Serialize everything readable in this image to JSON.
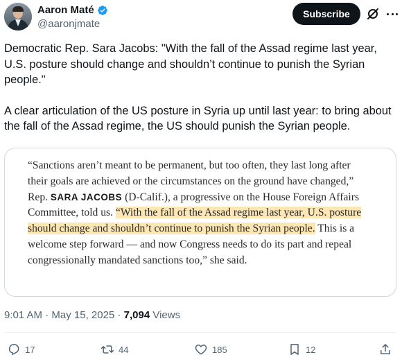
{
  "author": {
    "display_name": "Aaron Maté",
    "handle": "@aaronjmate"
  },
  "header": {
    "subscribe_label": "Subscribe"
  },
  "tweet": {
    "paragraph_1": "Democratic Rep. Sara Jacobs: \"With the fall of the Assad regime last year, U.S. posture should change and shouldn’t continue to punish the Syrian people.\"",
    "paragraph_2": "A clear articulation of the US posture in Syria up until last year: to bring about the fall of the Assad regime, the US should punish the Syrian people."
  },
  "media": {
    "quote_part_1": "“Sanctions aren’t meant to be permanent, but too often, they last long after their goals are achieved or the circumstances on the ground have changed,” Rep. ",
    "quote_name": "SARA JACOBS",
    "quote_part_2": " (D-Calif.), a progressive on the House Foreign Affairs Committee, told us. ",
    "quote_highlight": "“With the fall of the Assad regime last year, U.S. posture should change and shouldn’t continue to punish the Syrian people.",
    "quote_part_3": " This is a welcome step forward — and now Congress needs to do its part and repeal congressionally mandated sanctions too,” she said."
  },
  "meta": {
    "time": "9:01 AM",
    "sep1": " · ",
    "date": "May 15, 2025",
    "sep2": " · ",
    "views_count": "7,094",
    "views_label": " Views"
  },
  "actions": {
    "replies": "17",
    "reposts": "44",
    "likes": "185",
    "bookmarks": "12"
  },
  "colors": {
    "text_primary": "#0f1419",
    "text_secondary": "#536471",
    "verified_blue": "#1d9bf0",
    "highlight": "#fbe6b4",
    "border": "#cfd9de"
  }
}
